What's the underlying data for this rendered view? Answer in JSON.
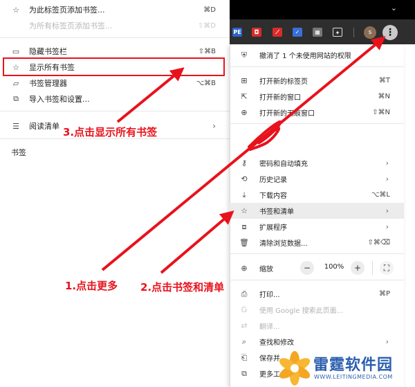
{
  "submenu": {
    "items": [
      {
        "icon": "☆",
        "label": "为此标签页添加书签...",
        "shortcut": "⌘D",
        "enabled": true
      },
      {
        "icon": "",
        "label": "为所有标签页添加书签...",
        "shortcut": "⇧⌘D",
        "enabled": false
      },
      {
        "icon": "▭",
        "label": "隐藏书签栏",
        "shortcut": "⇧⌘B",
        "enabled": true
      },
      {
        "icon": "☆",
        "label": "显示所有书签",
        "shortcut": "",
        "enabled": true
      },
      {
        "icon": "▱",
        "label": "书签管理器",
        "shortcut": "⌥⌘B",
        "enabled": true
      },
      {
        "icon": "⧉",
        "label": "导入书签和设置...",
        "shortcut": "",
        "enabled": true
      },
      {
        "icon": "☰",
        "label": "阅读清单",
        "shortcut": "",
        "enabled": true
      }
    ],
    "reading_arrow": "›",
    "bookmarks_heading": "书签"
  },
  "toolbar": {
    "chevron": "⌄",
    "avatar_letter": "s",
    "more_icon": "⋮",
    "extensions": [
      {
        "label": "PE",
        "color": "#2c63c9"
      },
      {
        "label": "◘",
        "color": "#d92b2b"
      },
      {
        "label": "⟋",
        "color": "#d92b2b"
      },
      {
        "label": "✓",
        "color": "#3a6fd8"
      },
      {
        "label": "▦",
        "color": "#777777"
      },
      {
        "label": "✦",
        "color": "#2e2e2e"
      }
    ]
  },
  "menu": {
    "notice": {
      "icon": "⛨",
      "label": "撤消了 1 个未使用网站的权限"
    },
    "items": [
      {
        "icon": "⊞",
        "label": "打开新的标签页",
        "shortcut": "⌘T",
        "arrow": "",
        "enabled": true
      },
      {
        "icon": "⇱",
        "label": "打开新的窗口",
        "shortcut": "⌘N",
        "arrow": "",
        "enabled": true
      },
      {
        "icon": "⊕",
        "label": "打开新的无痕窗口",
        "shortcut": "⇧⌘N",
        "arrow": "",
        "enabled": true
      },
      {
        "icon": "⚷",
        "label": "密码和自动填充",
        "shortcut": "",
        "arrow": "›",
        "enabled": true
      },
      {
        "icon": "⟲",
        "label": "历史记录",
        "shortcut": "",
        "arrow": "›",
        "enabled": true
      },
      {
        "icon": "⤓",
        "label": "下载内容",
        "shortcut": "⌥⌘L",
        "arrow": "",
        "enabled": true
      },
      {
        "icon": "☆",
        "label": "书签和清单",
        "shortcut": "",
        "arrow": "›",
        "enabled": true
      },
      {
        "icon": "⧈",
        "label": "扩展程序",
        "shortcut": "",
        "arrow": "›",
        "enabled": true
      },
      {
        "icon": "🗑",
        "label": "清除浏览数据...",
        "shortcut": "⇧⌘⌫",
        "arrow": "",
        "enabled": true
      }
    ],
    "zoom": {
      "icon": "⊕",
      "label": "缩放",
      "minus": "−",
      "value": "100%",
      "plus": "+",
      "fullscreen": "⛶"
    },
    "items2": [
      {
        "icon": "⎙",
        "label": "打印...",
        "shortcut": "⌘P",
        "arrow": "",
        "enabled": true
      },
      {
        "icon": "G",
        "label": "使用 Google 搜索此页面...",
        "shortcut": "",
        "arrow": "",
        "enabled": false
      },
      {
        "icon": "⇄",
        "label": "翻译...",
        "shortcut": "",
        "arrow": "",
        "enabled": false
      },
      {
        "icon": "⌕",
        "label": "查找和修改",
        "shortcut": "",
        "arrow": "›",
        "enabled": true
      },
      {
        "icon": "⎗",
        "label": "保存并",
        "shortcut": "",
        "arrow": "",
        "enabled": true
      },
      {
        "icon": "⧉",
        "label": "更多工",
        "shortcut": "",
        "arrow": "",
        "enabled": true
      }
    ]
  },
  "annotations": {
    "step1": "1.点击更多",
    "step2": "2.点击书签和清单",
    "step3": "3.点击显示所有书签",
    "color": "#e8121c"
  },
  "watermark": {
    "title": "雷霆软件园",
    "url": "WWW.LEITINGMEDIA.COM"
  }
}
